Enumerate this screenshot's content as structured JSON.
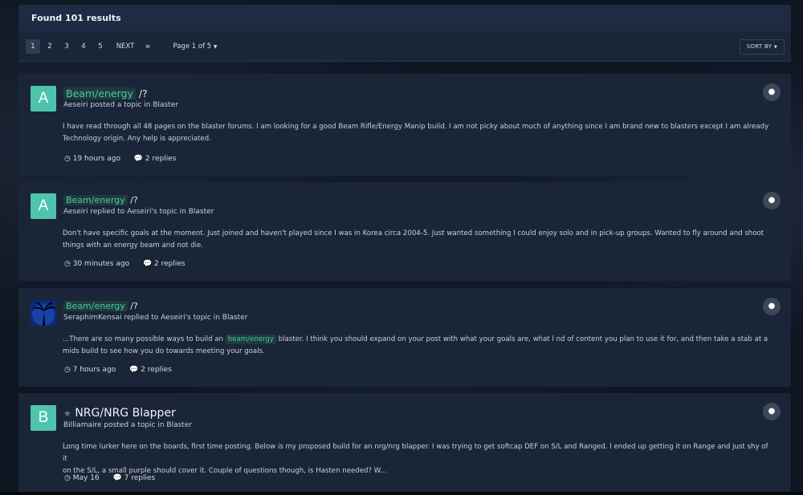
{
  "header": {
    "title": "Found 101 results"
  },
  "pagination": {
    "pages": [
      "1",
      "2",
      "3",
      "4",
      "5"
    ],
    "next_label": "NEXT",
    "last_label": "»",
    "page_of": "Page 1 of 5",
    "sort_label": "SORT BY"
  },
  "results": [
    {
      "avatar_letter": "A",
      "title_highlight": "Beam/energy",
      "title_rest": " /?",
      "meta": "Aeseiri posted a topic in Blaster",
      "body_line1": "I have read through all 48 pages on the blaster forums. I am looking for a good Beam Rifle/Energy Manip build. I am not picky about much of anything since I am brand new to blasters except I am already",
      "body_line2": "Technology origin. Any help is appreciated.",
      "time": "19 hours ago",
      "replies": "2 replies"
    },
    {
      "avatar_letter": "A",
      "title_highlight": "Beam/energy",
      "title_rest": " /?",
      "meta": "Aeseiri replied to Aeseiri's topic in Blaster",
      "body_line1": "Don't have specific goals at the moment. Just joined and haven't played since I was in Korea circa 2004-5. Just wanted something I could enjoy solo and in pick-up groups. Wanted to fly around and shoot",
      "body_line2": "things with an energy beam and not die.",
      "time": "30 minutes ago",
      "replies": "2 replies"
    },
    {
      "avatar_letter": "",
      "title_highlight": "Beam/energy",
      "title_rest": " /?",
      "meta": "SeraphimKensai replied to Aeseiri's topic in Blaster",
      "body_pre": "...There are so many possible ways to build an ",
      "body_highlight": "beam/energy",
      "body_post": " blaster. I think you should expand on your post with what your goals are, what l nd of content you plan to use it for, and then take a stab at a",
      "body_line2": "mids build to see how you do towards meeting your goals.",
      "time": "7 hours ago",
      "replies": "2 replies"
    },
    {
      "avatar_letter": "B",
      "title": "NRG/NRG Blapper",
      "meta": "Billiamaire posted a topic in Blaster",
      "body_line1": "Long time lurker here on the boards, first time posting. Below is my proposed build for an nrg/nrg blapper. I was trying to get softcap DEF on S/L and Ranged. I ended up getting it on Range and just shy of it",
      "body_line2": "on the S/L, a small purple should cover it. Couple of questions though, is Hasten needed? W...",
      "time": "May 16",
      "replies": "7 replies"
    }
  ],
  "icons": {
    "clock": "clock-icon",
    "comment": "comment-icon",
    "bubble": "comment-bubble-icon",
    "star": "star-icon"
  },
  "colors": {
    "accent": "#48c9a6",
    "avatar": "#4fc4ad",
    "card": "#1a2538",
    "header": "#1e2b42"
  }
}
